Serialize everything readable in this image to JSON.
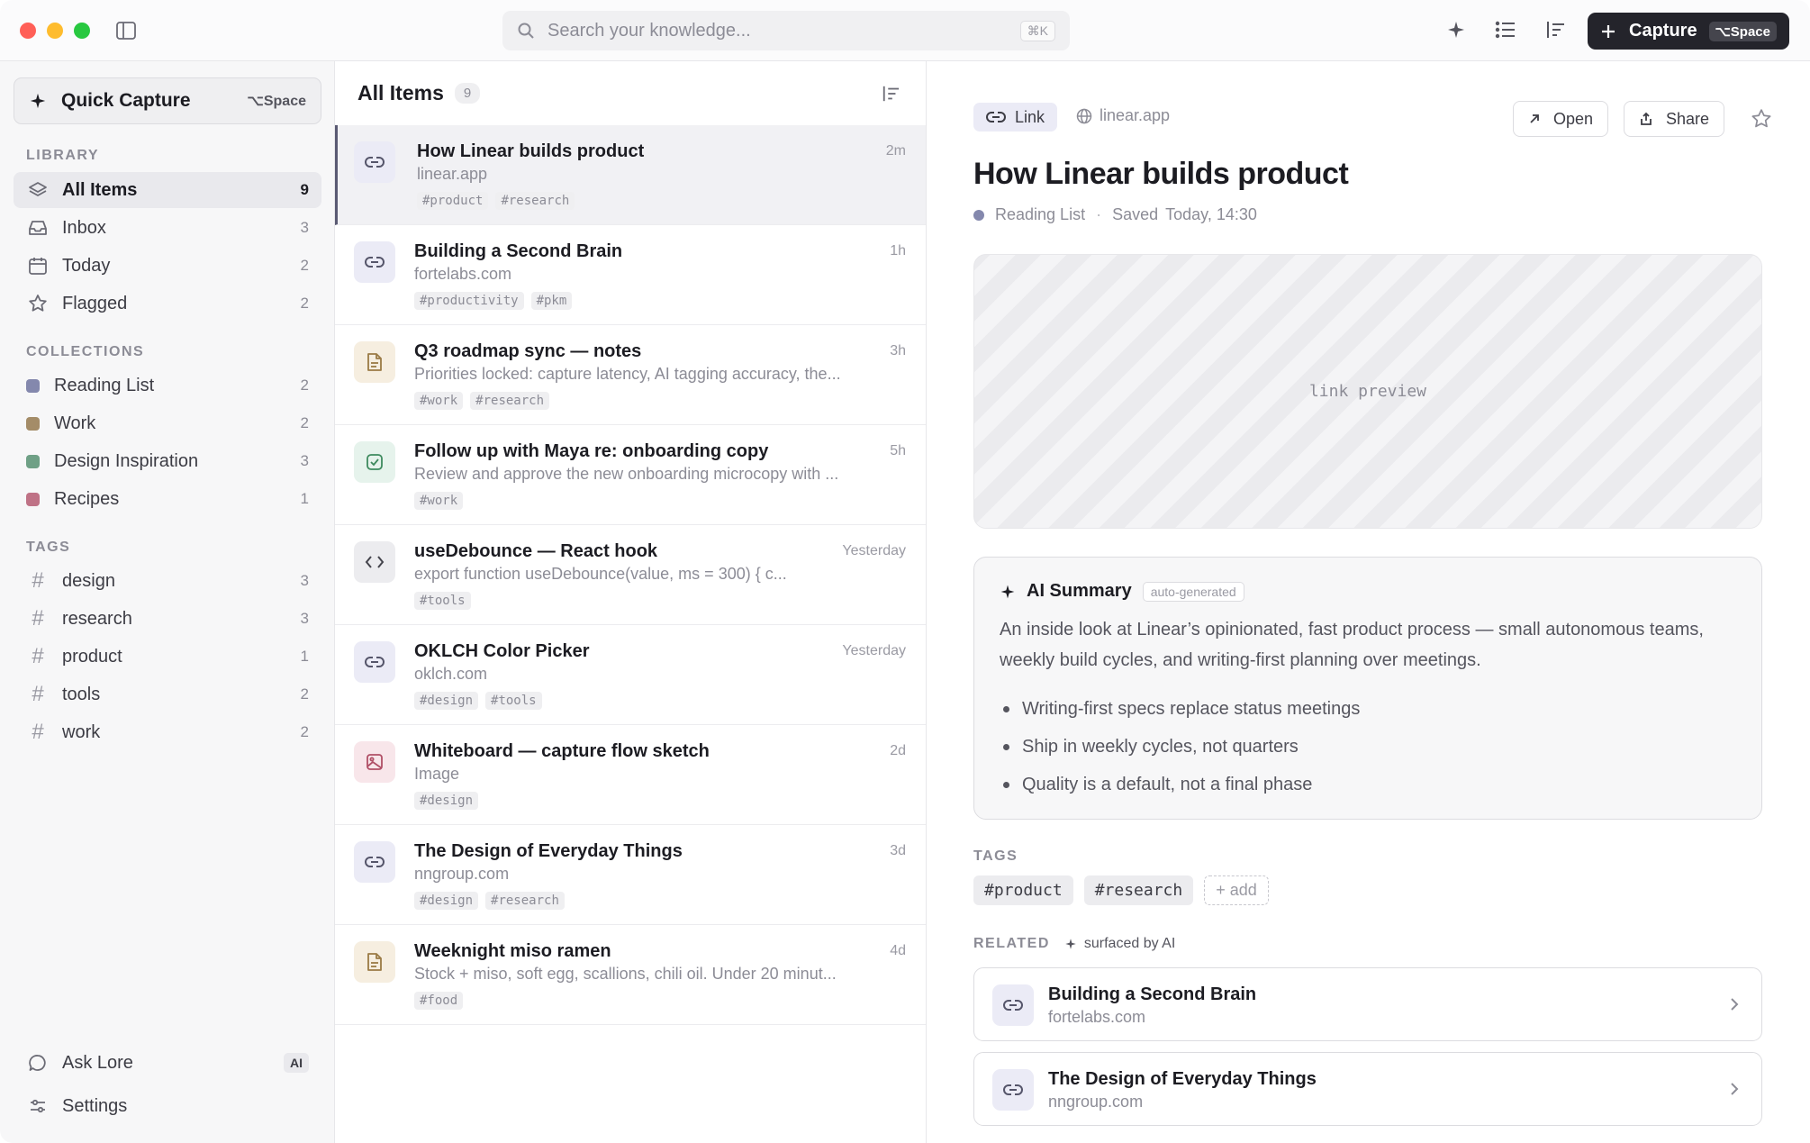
{
  "titlebar": {
    "search_placeholder": "Search your knowledge...",
    "search_shortcut": "⌘K",
    "capture_label": "Capture",
    "capture_shortcut": "⌥Space"
  },
  "sidebar": {
    "quick_capture": {
      "label": "Quick Capture",
      "shortcut": "⌥Space"
    },
    "library_label": "LIBRARY",
    "library": [
      {
        "label": "All Items",
        "count": "9",
        "icon": "layers-icon"
      },
      {
        "label": "Inbox",
        "count": "3",
        "icon": "inbox-icon"
      },
      {
        "label": "Today",
        "count": "2",
        "icon": "calendar-icon"
      },
      {
        "label": "Flagged",
        "count": "2",
        "icon": "star-icon"
      }
    ],
    "collections_label": "COLLECTIONS",
    "collections": [
      {
        "label": "Reading List",
        "count": "2",
        "color": "#8488ad"
      },
      {
        "label": "Work",
        "count": "2",
        "color": "#a48c68"
      },
      {
        "label": "Design Inspiration",
        "count": "3",
        "color": "#6fa086"
      },
      {
        "label": "Recipes",
        "count": "1",
        "color": "#bf7286"
      }
    ],
    "tags_label": "TAGS",
    "tags": [
      {
        "label": "design",
        "count": "3"
      },
      {
        "label": "research",
        "count": "3"
      },
      {
        "label": "product",
        "count": "1"
      },
      {
        "label": "tools",
        "count": "2"
      },
      {
        "label": "work",
        "count": "2"
      }
    ],
    "ask": {
      "label": "Ask Lore",
      "badge": "AI"
    },
    "settings": {
      "label": "Settings"
    }
  },
  "list": {
    "title": "All Items",
    "count": "9",
    "items": [
      {
        "title": "How Linear builds product",
        "subtitle": "linear.app",
        "time": "2m",
        "type": "link",
        "tags": [
          "#product",
          "#research"
        ]
      },
      {
        "title": "Building a Second Brain",
        "subtitle": "fortelabs.com",
        "time": "1h",
        "type": "link",
        "tags": [
          "#productivity",
          "#pkm"
        ]
      },
      {
        "title": "Q3 roadmap sync — notes",
        "subtitle": "Priorities locked: capture latency, AI tagging accuracy, the...",
        "time": "3h",
        "type": "note",
        "tags": [
          "#work",
          "#research"
        ]
      },
      {
        "title": "Follow up with Maya re: onboarding copy",
        "subtitle": "Review and approve the new onboarding microcopy with ...",
        "time": "5h",
        "type": "task",
        "tags": [
          "#work"
        ]
      },
      {
        "title": "useDebounce — React hook",
        "subtitle": "export function useDebounce(value, ms = 300) { c...",
        "time": "Yesterday",
        "type": "code",
        "tags": [
          "#tools"
        ]
      },
      {
        "title": "OKLCH Color Picker",
        "subtitle": "oklch.com",
        "time": "Yesterday",
        "type": "link",
        "tags": [
          "#design",
          "#tools"
        ]
      },
      {
        "title": "Whiteboard — capture flow sketch",
        "subtitle": "Image",
        "time": "2d",
        "type": "img",
        "tags": [
          "#design"
        ]
      },
      {
        "title": "The Design of Everyday Things",
        "subtitle": "nngroup.com",
        "time": "3d",
        "type": "link",
        "tags": [
          "#design",
          "#research"
        ]
      },
      {
        "title": "Weeknight miso ramen",
        "subtitle": "Stock + miso, soft egg, scallions, chili oil. Under 20 minut...",
        "time": "4d",
        "type": "note",
        "tags": [
          "#food"
        ]
      }
    ]
  },
  "detail": {
    "type_label": "Link",
    "source": "linear.app",
    "open_label": "Open",
    "share_label": "Share",
    "title": "How Linear builds product",
    "collection": "Reading List",
    "saved_label": "Saved",
    "saved_time": "Today, 14:30",
    "preview_label": "link preview",
    "ai_summary": {
      "heading": "AI Summary",
      "badge": "auto-generated",
      "text": "An inside look at Linear’s opinionated, fast product process — small autonomous teams, weekly build cycles, and writing-first planning over meetings.",
      "bullets": [
        "Writing-first specs replace status meetings",
        "Ship in weekly cycles, not quarters",
        "Quality is a default, not a final phase"
      ]
    },
    "tags_label": "TAGS",
    "tags": [
      "#product",
      "#research"
    ],
    "add_tag_label": "+ add",
    "related_label": "RELATED",
    "related_sub": "surfaced by AI",
    "related": [
      {
        "title": "Building a Second Brain",
        "subtitle": "fortelabs.com"
      },
      {
        "title": "The Design of Everyday Things",
        "subtitle": "nngroup.com"
      }
    ]
  }
}
